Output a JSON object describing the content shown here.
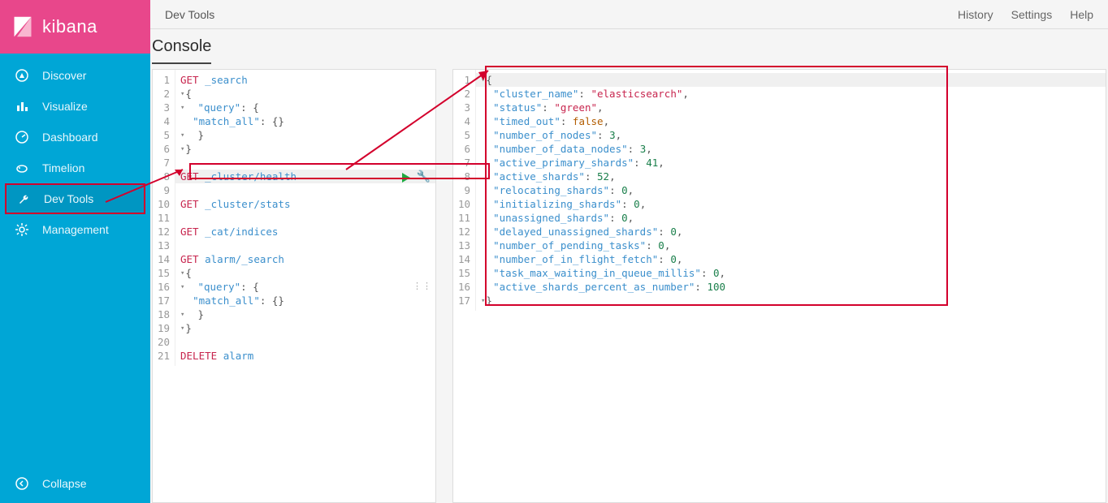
{
  "brand": {
    "name": "kibana"
  },
  "sidebar": {
    "items": [
      {
        "label": "Discover",
        "icon": "compass-icon"
      },
      {
        "label": "Visualize",
        "icon": "barchart-icon"
      },
      {
        "label": "Dashboard",
        "icon": "gauge-icon"
      },
      {
        "label": "Timelion",
        "icon": "piggy-icon"
      },
      {
        "label": "Dev Tools",
        "icon": "wrench-icon"
      },
      {
        "label": "Management",
        "icon": "gear-icon"
      }
    ],
    "collapse_label": "Collapse"
  },
  "topbar": {
    "title": "Dev Tools",
    "links": [
      "History",
      "Settings",
      "Help"
    ]
  },
  "console": {
    "title": "Console"
  },
  "editor": {
    "lines": [
      {
        "n": 1,
        "method": "GET",
        "path": "_search"
      },
      {
        "n": 2,
        "fold": true,
        "text": "{"
      },
      {
        "n": 3,
        "fold": true,
        "key": "\"query\"",
        "rest": ": {"
      },
      {
        "n": 4,
        "key": "\"match_all\"",
        "rest": ": {}"
      },
      {
        "n": 5,
        "fold": true,
        "text": "  }"
      },
      {
        "n": 6,
        "fold": true,
        "text": "}"
      },
      {
        "n": 7,
        "text": ""
      },
      {
        "n": 8,
        "hl": true,
        "method": "GET",
        "path": "_cluster/health"
      },
      {
        "n": 9,
        "text": ""
      },
      {
        "n": 10,
        "method": "GET",
        "path": "_cluster/stats"
      },
      {
        "n": 11,
        "text": ""
      },
      {
        "n": 12,
        "method": "GET",
        "path": "_cat/indices"
      },
      {
        "n": 13,
        "text": ""
      },
      {
        "n": 14,
        "method": "GET",
        "path": "alarm/_search"
      },
      {
        "n": 15,
        "fold": true,
        "text": "{"
      },
      {
        "n": 16,
        "fold": true,
        "key": "\"query\"",
        "rest": ": {"
      },
      {
        "n": 17,
        "key": "\"match_all\"",
        "rest": ": {}"
      },
      {
        "n": 18,
        "fold": true,
        "text": "  }"
      },
      {
        "n": 19,
        "fold": true,
        "text": "}"
      },
      {
        "n": 20,
        "text": ""
      },
      {
        "n": 21,
        "method": "DELETE",
        "path": "alarm"
      }
    ]
  },
  "response": {
    "lines": [
      {
        "n": 1,
        "fold": true,
        "raw": "{"
      },
      {
        "n": 2,
        "k": "\"cluster_name\"",
        "v": "\"elasticsearch\"",
        "vt": "str",
        "c": true
      },
      {
        "n": 3,
        "k": "\"status\"",
        "v": "\"green\"",
        "vt": "str",
        "c": true
      },
      {
        "n": 4,
        "k": "\"timed_out\"",
        "v": "false",
        "vt": "bool",
        "c": true
      },
      {
        "n": 5,
        "k": "\"number_of_nodes\"",
        "v": "3",
        "vt": "num",
        "c": true
      },
      {
        "n": 6,
        "k": "\"number_of_data_nodes\"",
        "v": "3",
        "vt": "num",
        "c": true
      },
      {
        "n": 7,
        "k": "\"active_primary_shards\"",
        "v": "41",
        "vt": "num",
        "c": true
      },
      {
        "n": 8,
        "k": "\"active_shards\"",
        "v": "52",
        "vt": "num",
        "c": true
      },
      {
        "n": 9,
        "k": "\"relocating_shards\"",
        "v": "0",
        "vt": "num",
        "c": true
      },
      {
        "n": 10,
        "k": "\"initializing_shards\"",
        "v": "0",
        "vt": "num",
        "c": true
      },
      {
        "n": 11,
        "k": "\"unassigned_shards\"",
        "v": "0",
        "vt": "num",
        "c": true
      },
      {
        "n": 12,
        "k": "\"delayed_unassigned_shards\"",
        "v": "0",
        "vt": "num",
        "c": true
      },
      {
        "n": 13,
        "k": "\"number_of_pending_tasks\"",
        "v": "0",
        "vt": "num",
        "c": true
      },
      {
        "n": 14,
        "k": "\"number_of_in_flight_fetch\"",
        "v": "0",
        "vt": "num",
        "c": true
      },
      {
        "n": 15,
        "k": "\"task_max_waiting_in_queue_millis\"",
        "v": "0",
        "vt": "num",
        "c": true
      },
      {
        "n": 16,
        "k": "\"active_shards_percent_as_number\"",
        "v": "100",
        "vt": "num",
        "c": false
      },
      {
        "n": 17,
        "fold": true,
        "raw": "}"
      }
    ]
  }
}
